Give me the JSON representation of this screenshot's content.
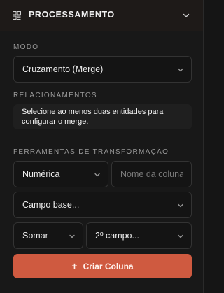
{
  "header": {
    "title": "PROCESSAMENTO",
    "icon": "grid-icon",
    "toggle_icon": "chevron-down-icon"
  },
  "mode": {
    "label": "MODO",
    "selected": "Cruzamento (Merge)"
  },
  "relationships": {
    "label": "RELACIONAMENTOS",
    "message": "Selecione ao menos duas entidades para configurar o merge."
  },
  "tools": {
    "label": "FERRAMENTAS DE TRANSFORMAÇÃO",
    "type_selected": "Numérica",
    "column_name_placeholder": "Nome da coluna",
    "base_field_selected": "Campo base...",
    "operation_selected": "Somar",
    "second_field_selected": "2º campo...",
    "create_button": "Criar Coluna",
    "create_icon": "plus-icon"
  },
  "colors": {
    "accent": "#cf5a40",
    "background": "#181818",
    "header": "#1e1a18"
  }
}
